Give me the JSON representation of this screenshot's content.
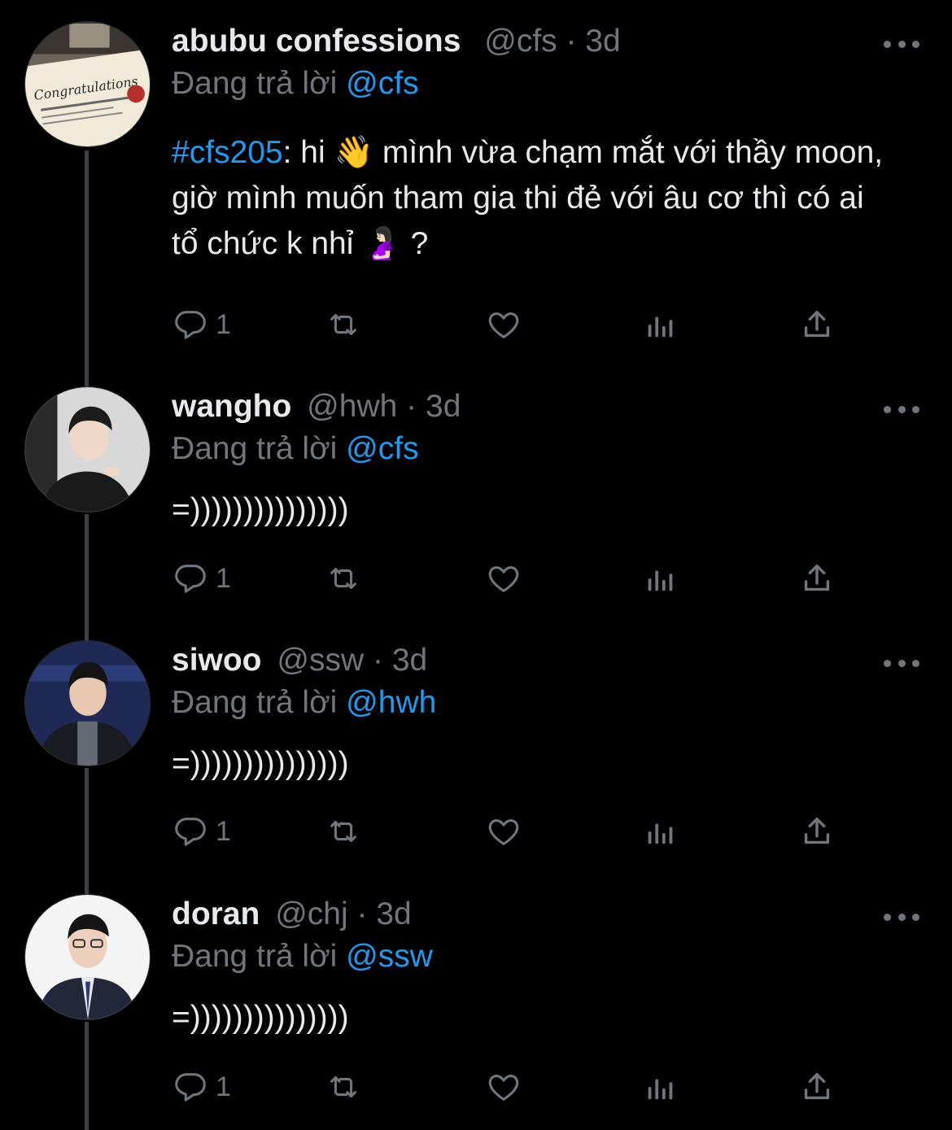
{
  "theme": {
    "background": "#000000",
    "accent": "#1d9bf0",
    "secondary": "#71767b",
    "primary_text": "#e7e9ea"
  },
  "tweets": [
    {
      "name": "abubu confessions",
      "handle": "@cfs",
      "dot": "·",
      "time": "3d",
      "replying_prefix": "Đang trả lời",
      "replying_to": "@cfs",
      "hashtag": "#cfs205",
      "text_after_hashtag": ": hi 👋  mình vừa chạm mắt với thầy moon, giờ mình muốn tham gia thi đẻ với âu cơ thì có ai tổ chức k nhỉ 🤰🏻 ?",
      "reply_count": "1",
      "avatar_icon": "certificate-avatar"
    },
    {
      "name": "wangho",
      "handle": "@hwh",
      "dot": "·",
      "time": "3d",
      "replying_prefix": "Đang trả lời",
      "replying_to": "@cfs",
      "text": "=)))))))))))))))",
      "reply_count": "1",
      "avatar_icon": "person-avatar"
    },
    {
      "name": "siwoo",
      "handle": "@ssw",
      "dot": "·",
      "time": "3d",
      "replying_prefix": "Đang trả lời",
      "replying_to": "@hwh",
      "text": "=)))))))))))))))",
      "reply_count": "1",
      "avatar_icon": "person-avatar"
    },
    {
      "name": "doran",
      "handle": "@chj",
      "dot": "·",
      "time": "3d",
      "replying_prefix": "Đang trả lời",
      "replying_to": "@ssw",
      "text": "=)))))))))))))))",
      "reply_count": "1",
      "avatar_icon": "person-avatar"
    }
  ],
  "action_icons": [
    "reply-icon",
    "retweet-icon",
    "like-icon",
    "views-icon",
    "share-icon"
  ]
}
